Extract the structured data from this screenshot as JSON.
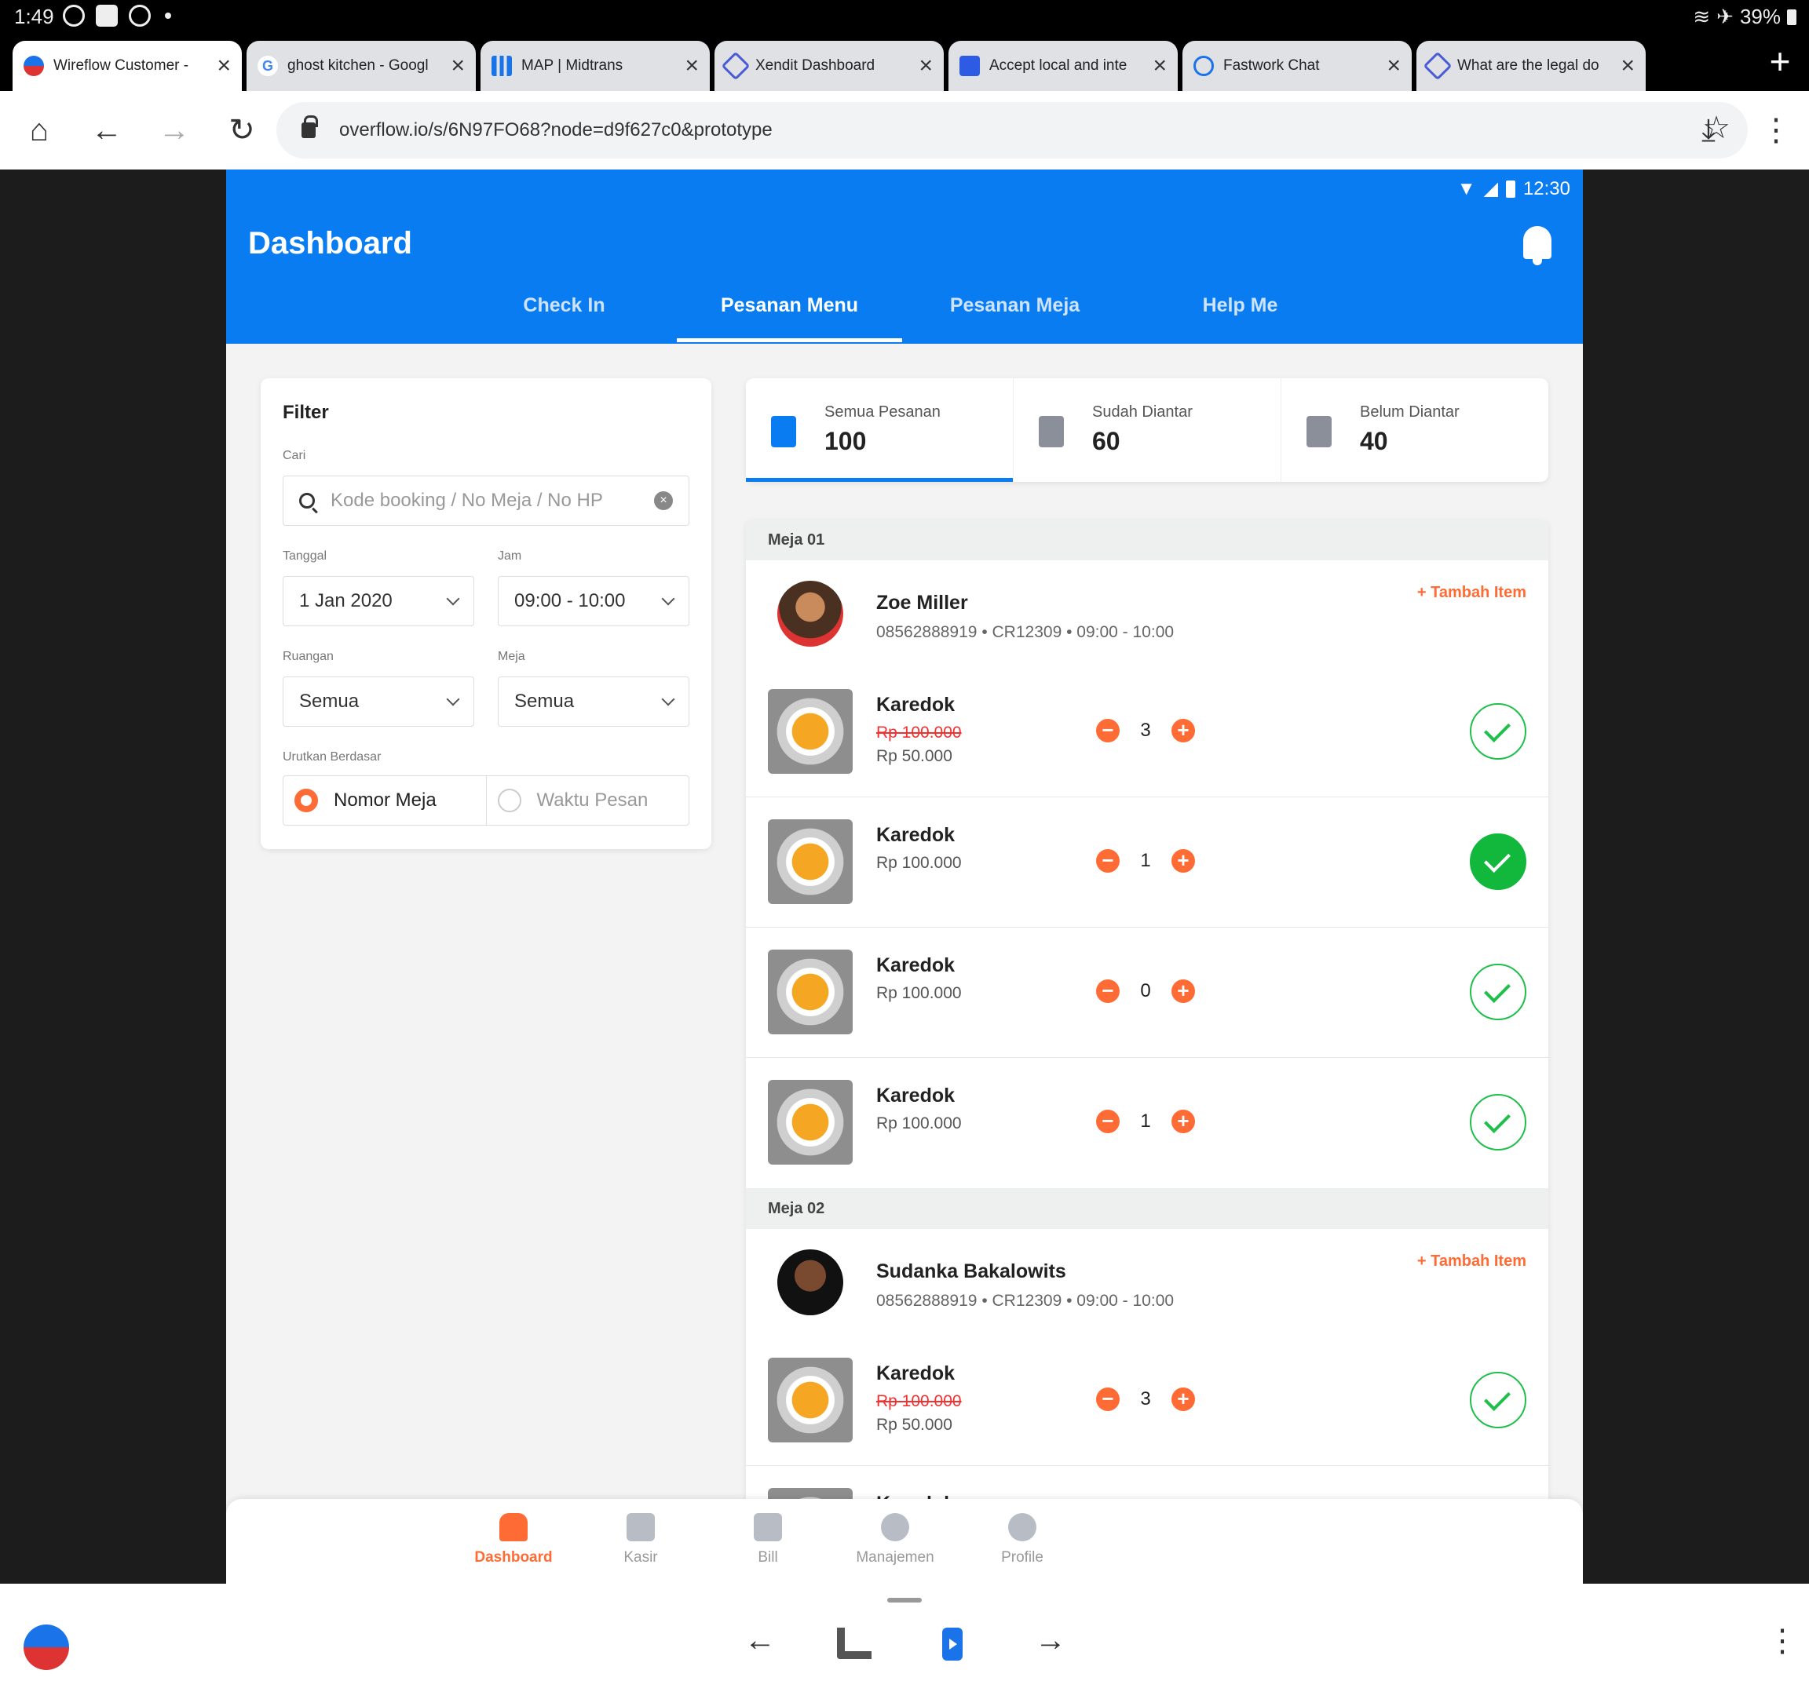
{
  "status_bar": {
    "time": "1:49",
    "battery": "39%"
  },
  "browser": {
    "tabs": [
      {
        "title": "Wireflow Customer -",
        "active": true
      },
      {
        "title": "ghost kitchen - Googl"
      },
      {
        "title": "MAP | Midtrans"
      },
      {
        "title": "Xendit Dashboard"
      },
      {
        "title": "Accept local and inte"
      },
      {
        "title": "Fastwork Chat"
      },
      {
        "title": "What are the legal do"
      }
    ],
    "url": "overflow.io/s/6N97FO68?node=d9f627c0&prototype",
    "accent": "#1a73e8"
  },
  "app": {
    "status_time": "12:30",
    "title": "Dashboard",
    "primary_color": "#0a7cf2",
    "accent_color": "#ff6b35",
    "nav_tabs": [
      {
        "label": "Check In"
      },
      {
        "label": "Pesanan Menu",
        "active": true
      },
      {
        "label": "Pesanan Meja"
      },
      {
        "label": "Help Me"
      }
    ],
    "filter": {
      "title": "Filter",
      "cari_label": "Cari",
      "search_placeholder": "Kode booking / No Meja / No HP",
      "tanggal_label": "Tanggal",
      "tanggal_value": "1 Jan 2020",
      "jam_label": "Jam",
      "jam_value": "09:00 - 10:00",
      "ruangan_label": "Ruangan",
      "ruangan_value": "Semua",
      "meja_label": "Meja",
      "meja_value": "Semua",
      "urutkan_label": "Urutkan Berdasar",
      "sort_options": [
        "Nomor Meja",
        "Waktu Pesan"
      ],
      "sort_selected": "Nomor Meja"
    },
    "stats": [
      {
        "label": "Semua Pesanan",
        "value": "100",
        "active": true
      },
      {
        "label": "Sudah Diantar",
        "value": "60"
      },
      {
        "label": "Belum Diantar",
        "value": "40"
      }
    ],
    "tables": [
      {
        "name": "Meja 01",
        "customer": "Zoe Miller",
        "phone": "08562888919",
        "code": "CR12309",
        "time": "09:00 - 10:00",
        "add_label": "+ Tambah Item",
        "items": [
          {
            "name": "Karedok",
            "old_price": "Rp 100.000",
            "price": "Rp 50.000",
            "qty": "3",
            "delivered": false
          },
          {
            "name": "Karedok",
            "price": "Rp 100.000",
            "qty": "1",
            "delivered": true
          },
          {
            "name": "Karedok",
            "price": "Rp 100.000",
            "qty": "0",
            "delivered": false
          },
          {
            "name": "Karedok",
            "price": "Rp 100.000",
            "qty": "1",
            "delivered": false
          }
        ]
      },
      {
        "name": "Meja 02",
        "customer": "Sudanka Bakalowits",
        "phone": "08562888919",
        "code": "CR12309",
        "time": "09:00 - 10:00",
        "add_label": "+ Tambah Item",
        "items": [
          {
            "name": "Karedok",
            "old_price": "Rp 100.000",
            "price": "Rp 50.000",
            "qty": "3",
            "delivered": false
          },
          {
            "name": "Karedok"
          }
        ]
      }
    ],
    "bottom_nav": [
      {
        "label": "Dashboard",
        "active": true
      },
      {
        "label": "Kasir"
      },
      {
        "label": "Bill"
      },
      {
        "label": "Manajemen"
      },
      {
        "label": "Profile"
      }
    ]
  }
}
